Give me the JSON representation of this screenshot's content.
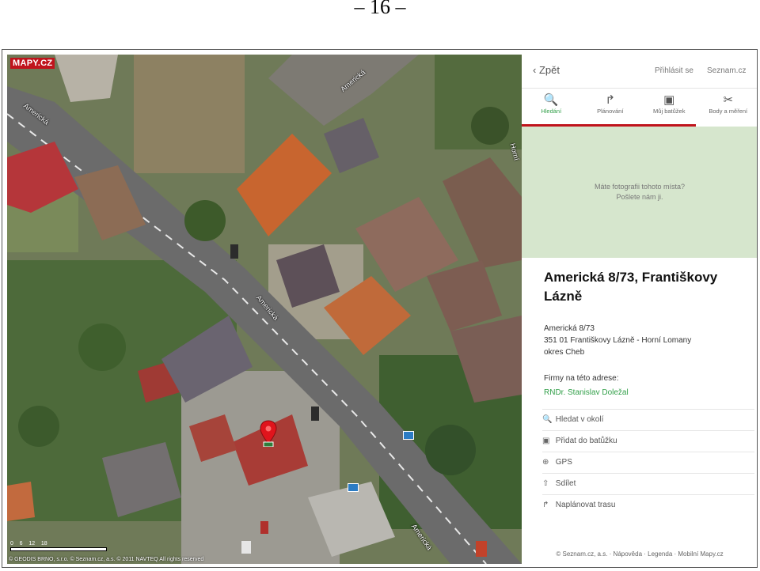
{
  "page_number": "– 16 –",
  "map": {
    "logo": "MAPY.CZ",
    "street_labels": [
      "Americká",
      "Americká",
      "Americká",
      "Americká",
      "Horní"
    ],
    "scale_ticks": "0    6    12    18",
    "copyright": "© GEODIS BRNO, s.r.o. © Seznam.cz, a.s. © 2011 NAVTEQ All rights reserved",
    "pin_icon": "location-pin-icon",
    "bus_stop_icon": "bus-stop-icon"
  },
  "panel": {
    "back_label": "Zpět",
    "login_label": "Přihlásit se",
    "seznam_label": "Seznam.cz",
    "tabs": [
      {
        "label": "Hledání",
        "icon": "🔍",
        "active": true
      },
      {
        "label": "Plánování",
        "icon": "↱",
        "active": false
      },
      {
        "label": "Můj batůžek",
        "icon": "▣",
        "active": false
      },
      {
        "label": "Body a měření",
        "icon": "✂",
        "active": false
      }
    ],
    "photo_prompt_line1": "Máte fotografii tohoto místa?",
    "photo_prompt_line2": "Pošlete nám ji.",
    "title": "Americká 8/73, Františkovy Lázně",
    "address_line1": "Americká 8/73",
    "address_line2": "351 01 Františkovy Lázně - Horní Lomany",
    "address_line3": "okres Cheb",
    "firms_label": "Firmy na této adrese:",
    "firm_name": "RNDr. Stanislav Doležal",
    "actions": [
      {
        "label": "Hledat v okolí",
        "icon": "🔍"
      },
      {
        "label": "Přidat do batůžku",
        "icon": "▣"
      },
      {
        "label": "GPS",
        "icon": "⊕"
      },
      {
        "label": "Sdílet",
        "icon": "⇧"
      },
      {
        "label": "Naplánovat trasu",
        "icon": "↱"
      }
    ],
    "footer": "© Seznam.cz, a.s. · Nápověda · Legenda · Mobilní Mapy.cz"
  }
}
